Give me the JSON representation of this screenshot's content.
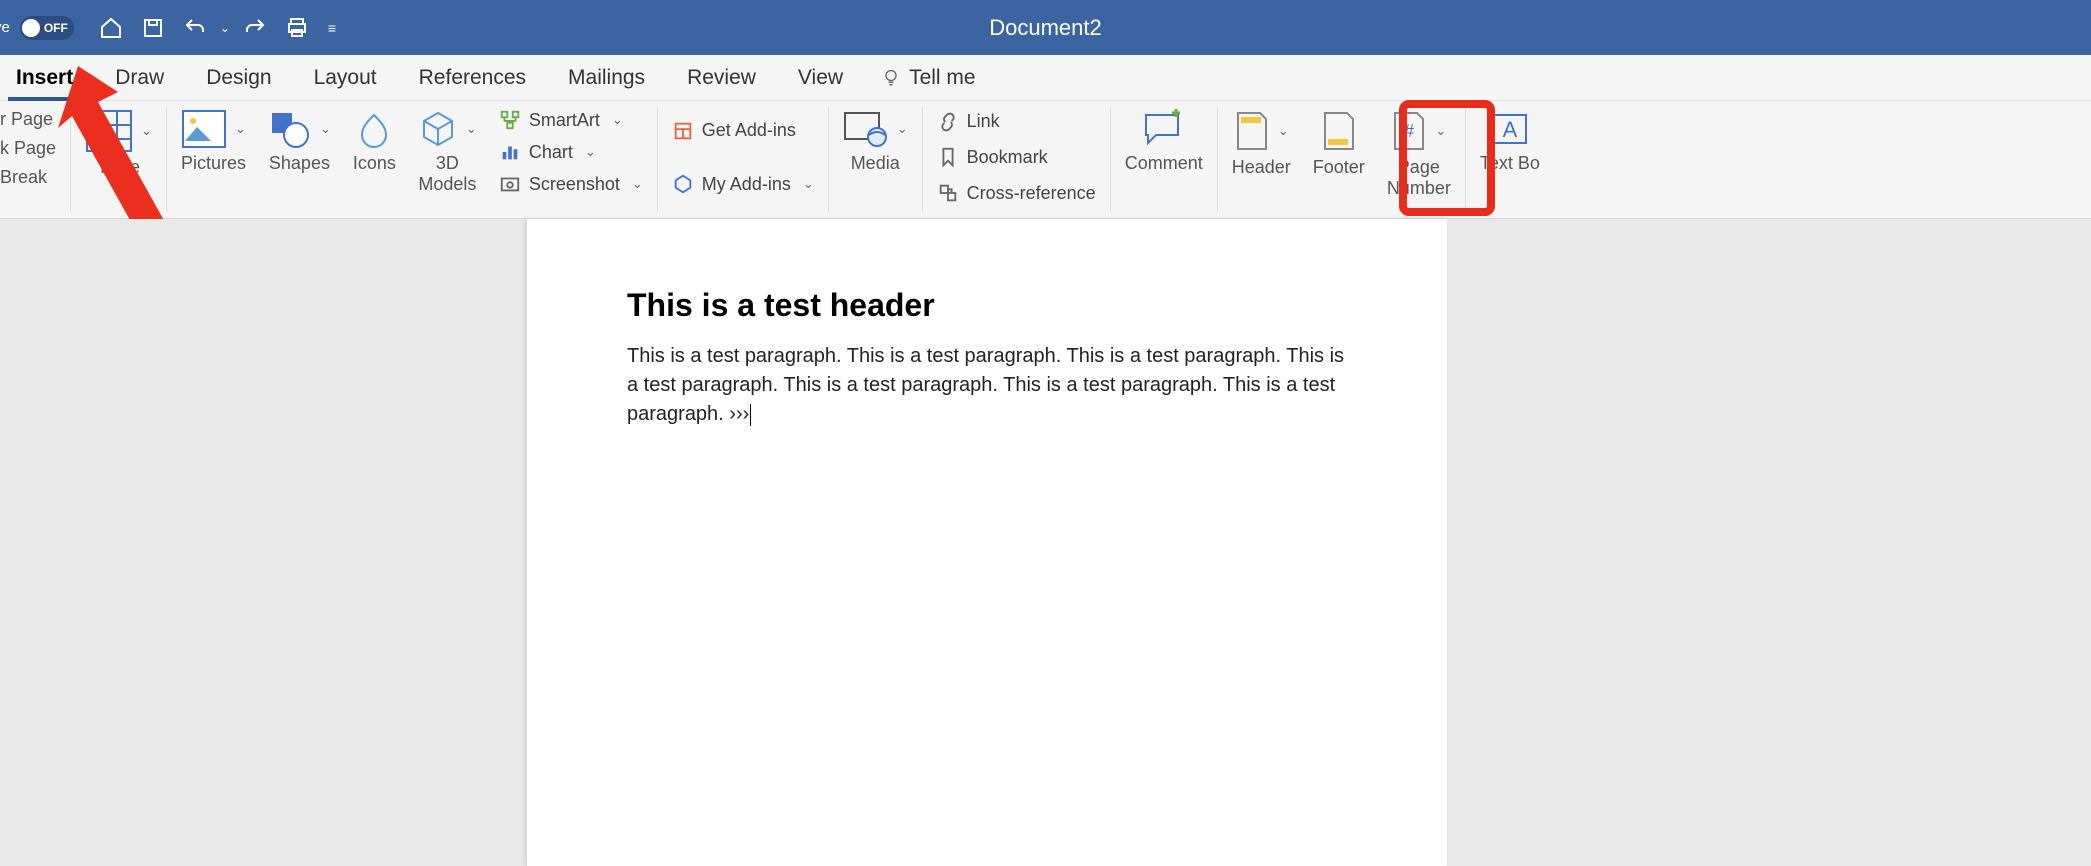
{
  "titlebar": {
    "autosave_partial": "ve",
    "toggle_label": "OFF",
    "document_title": "Document2"
  },
  "tabs": {
    "insert": "Insert",
    "draw": "Draw",
    "design": "Design",
    "layout": "Layout",
    "references": "References",
    "mailings": "Mailings",
    "review": "Review",
    "view": "View",
    "tellme": "Tell me"
  },
  "ribbon": {
    "left_items": {
      "cover_page": "r Page",
      "blank_page": "k Page",
      "page_break": "Break"
    },
    "table": "Table",
    "pictures": "Pictures",
    "shapes": "Shapes",
    "icons": "Icons",
    "models": "3D\nModels",
    "smartart": "SmartArt",
    "chart": "Chart",
    "screenshot": "Screenshot",
    "get_addins": "Get Add-ins",
    "my_addins": "My Add-ins",
    "media": "Media",
    "link": "Link",
    "bookmark": "Bookmark",
    "crossref": "Cross-reference",
    "comment": "Comment",
    "header": "Header",
    "footer": "Footer",
    "page_number": "Page\nNumber",
    "text_box": "Text Bo"
  },
  "document": {
    "header_text": "This is a test header",
    "paragraph_text": "This is a test paragraph. This is a test paragraph. This is a test paragraph. This is a test paragraph. This is a test paragraph. This is a test paragraph. This is a test paragraph. ›››"
  },
  "annotation": {
    "highlight_target": "page-number-button"
  }
}
